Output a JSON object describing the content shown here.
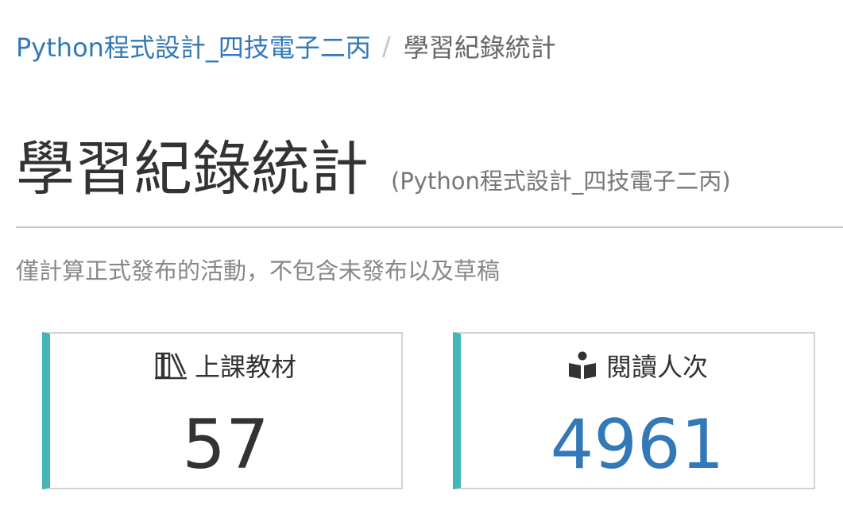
{
  "breadcrumb": {
    "course_link": "Python程式設計_四技電子二丙",
    "separator": "/",
    "current": "學習紀錄統計"
  },
  "header": {
    "title": "學習紀錄統計",
    "subtitle": "(Python程式設計_四技電子二丙)"
  },
  "note": "僅計算正式發布的活動，不包含未發布以及草稿",
  "stats": [
    {
      "icon": "books-icon",
      "label": "上課教材",
      "value": "57",
      "value_color": "#333333"
    },
    {
      "icon": "book-reader-icon",
      "label": "閱讀人次",
      "value": "4961",
      "value_color": "#3378b7"
    }
  ],
  "colors": {
    "link": "#3378b7",
    "accent_bar": "#45b5b5",
    "card_border": "#d2d2d2"
  }
}
